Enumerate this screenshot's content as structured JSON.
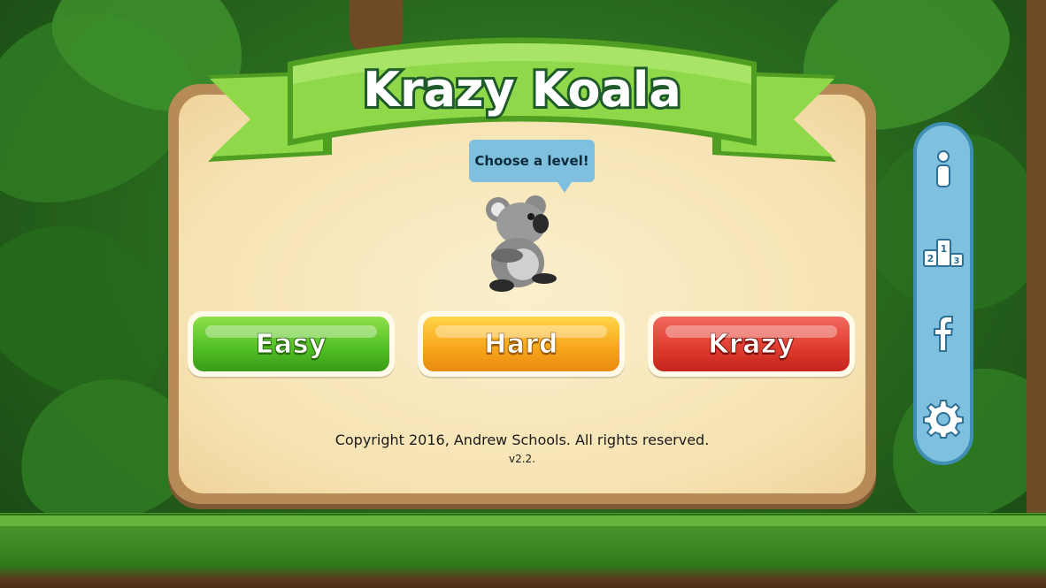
{
  "game": {
    "title": "Krazy Koala",
    "prompt": "Choose a level!",
    "levels": [
      {
        "label": "Easy",
        "color": "#4fbf24"
      },
      {
        "label": "Hard",
        "color": "#f7a41a"
      },
      {
        "label": "Krazy",
        "color": "#e03a2e"
      }
    ],
    "copyright": "Copyright 2016, Andrew Schools.  All rights reserved.",
    "version": "v2.2."
  },
  "sidebar": {
    "items": [
      {
        "icon": "info-icon"
      },
      {
        "icon": "leaderboard-podium-icon"
      },
      {
        "icon": "facebook-icon"
      },
      {
        "icon": "gear-icon"
      }
    ]
  },
  "colors": {
    "ribbon": "#8ed84a",
    "ribbon_dark": "#4f9e22",
    "panel": "#f6e3b3",
    "sidebar": "#7fc0df"
  }
}
